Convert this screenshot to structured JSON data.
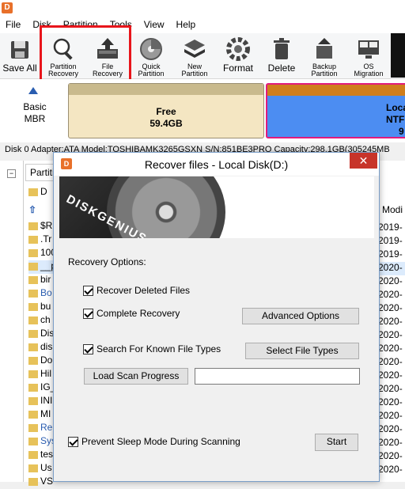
{
  "menu": [
    "File",
    "Disk",
    "Partition",
    "Tools",
    "View",
    "Help"
  ],
  "toolbar": {
    "save_all": "Save All",
    "partition_recovery": [
      "Partition",
      "Recovery"
    ],
    "file_recovery": [
      "File",
      "Recovery"
    ],
    "quick_partition": [
      "Quick",
      "Partition"
    ],
    "new_partition": [
      "New",
      "Partition"
    ],
    "format": "Format",
    "delete": "Delete",
    "backup_partition": [
      "Backup",
      "Partition"
    ],
    "os_migration": "OS Migration"
  },
  "diskmap": {
    "disk_type": [
      "Basic",
      "MBR"
    ],
    "free_label": "Free",
    "free_size": "59.4GB",
    "local_label": [
      "Loca",
      "NTF",
      "9"
    ]
  },
  "disk_info": "Disk 0 Adapter:ATA  Model:TOSHIBAMK3265GSXN  S/N:851BE3PRO  Capacity:298.1GB(305245MB",
  "file_list": {
    "tab": "Partiti",
    "modified_header": "Modi",
    "rows": [
      {
        "name": "D",
        "date": ""
      },
      {
        "name": "",
        "date": ""
      },
      {
        "name": "$R",
        "date": "2019-"
      },
      {
        "name": ".Tr",
        "date": "2019-"
      },
      {
        "name": "100",
        "date": "2019-"
      },
      {
        "name": "__p",
        "date": "2020-"
      },
      {
        "name": "bir",
        "date": "2020-"
      },
      {
        "name": "Bo",
        "date": "2020-"
      },
      {
        "name": "bu",
        "date": "2020-"
      },
      {
        "name": "ch",
        "date": "2020-"
      },
      {
        "name": "Dis",
        "date": "2020-"
      },
      {
        "name": "dis",
        "date": "2020-"
      },
      {
        "name": "Do",
        "date": "2020-"
      },
      {
        "name": "Hil",
        "date": "2020-"
      },
      {
        "name": "IG_",
        "date": "2020-"
      },
      {
        "name": "INI",
        "date": "2020-"
      },
      {
        "name": "MI",
        "date": "2020-"
      },
      {
        "name": "Re",
        "date": "2020-"
      },
      {
        "name": "Sys",
        "date": "2020-"
      },
      {
        "name": "tes",
        "date": "2020-"
      },
      {
        "name": "Us",
        "date": "2020-"
      },
      {
        "name": "VS",
        "date": "2020-"
      }
    ]
  },
  "dialog": {
    "title": "Recover files - Local Disk(D:)",
    "close": "✕",
    "banner_text": "DISKGENIUS",
    "recovery_options_label": "Recovery Options:",
    "recover_deleted": "Recover Deleted Files",
    "complete_recovery": "Complete Recovery",
    "advanced_options": "Advanced Options",
    "search_known_types": "Search For Known File Types",
    "select_file_types": "Select File Types",
    "load_scan_progress": "Load Scan Progress",
    "scan_progress_value": "",
    "prevent_sleep": "Prevent Sleep Mode During Scanning",
    "start": "Start"
  }
}
